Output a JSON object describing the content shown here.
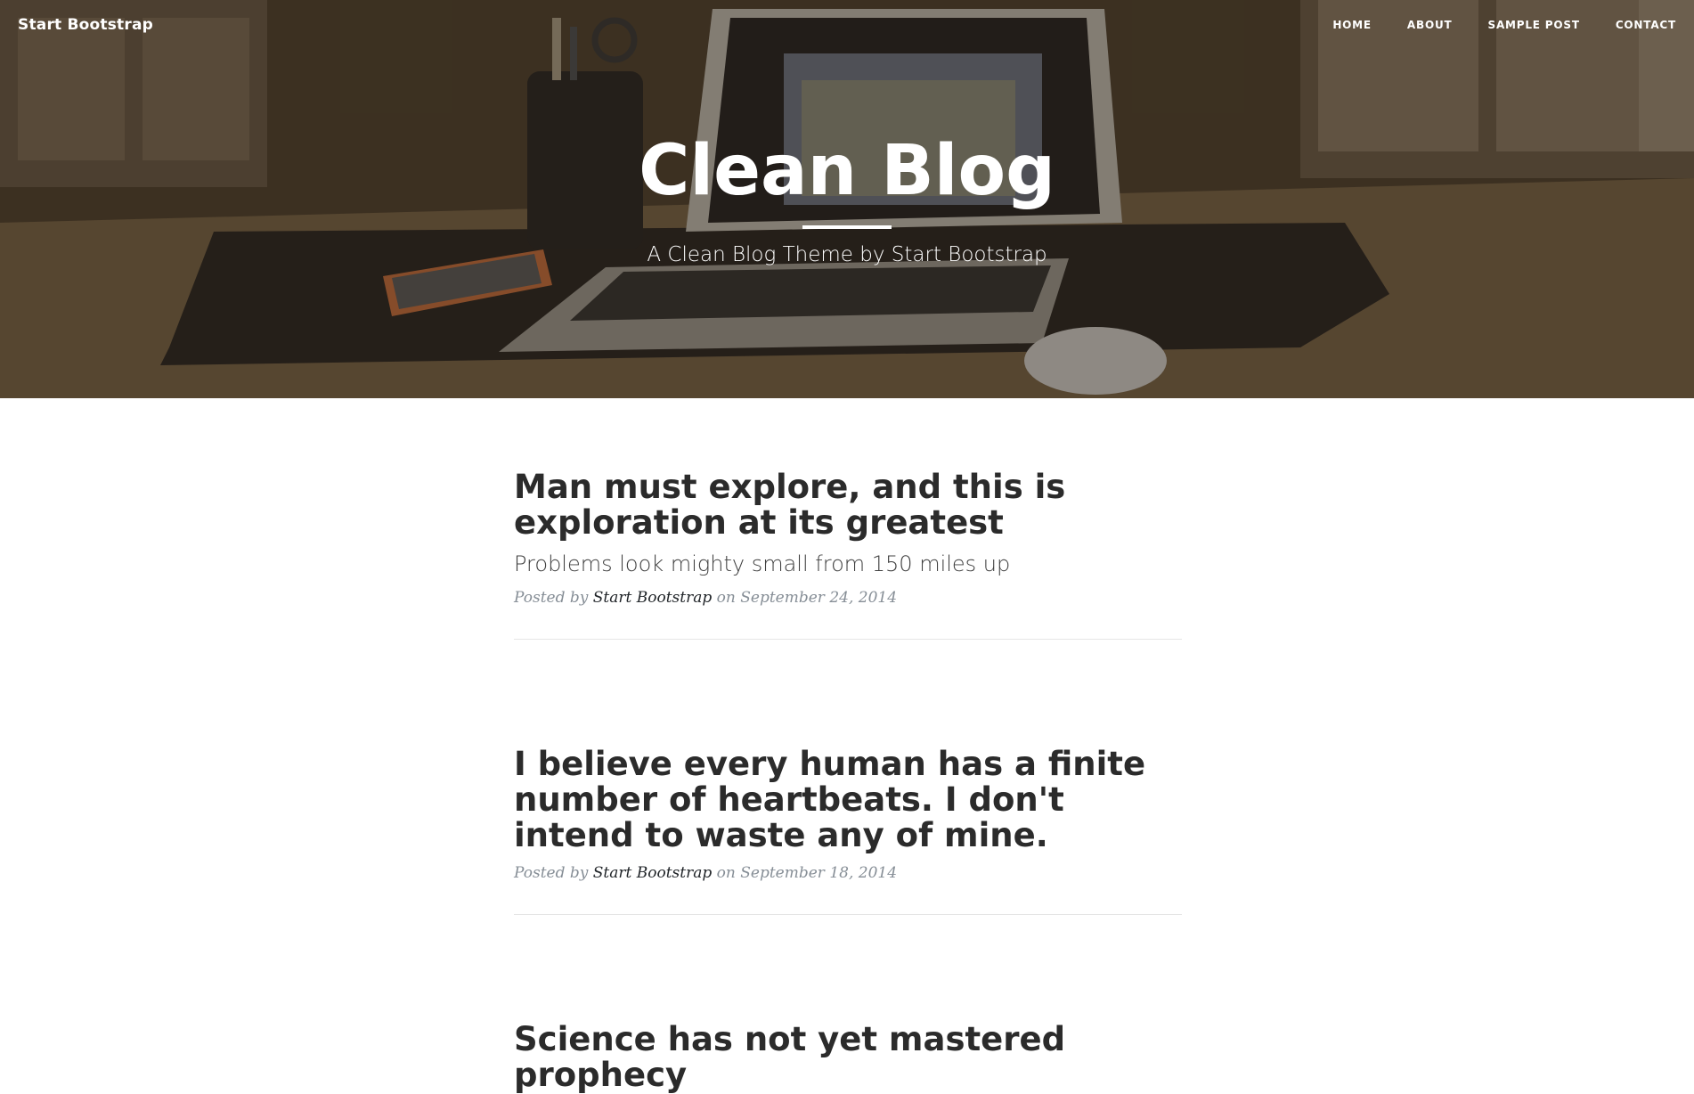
{
  "navbar": {
    "brand": "Start Bootstrap",
    "links": [
      "HOME",
      "ABOUT",
      "SAMPLE POST",
      "CONTACT"
    ]
  },
  "hero": {
    "title": "Clean Blog",
    "subtitle": "A Clean Blog Theme by Start Bootstrap"
  },
  "posts": [
    {
      "title": "Man must explore, and this is exploration at its greatest",
      "subtitle": "Problems look mighty small from 150 miles up",
      "meta_prefix": "Posted by",
      "author": "Start Bootstrap",
      "meta_on": "on",
      "date": "September 24, 2014"
    },
    {
      "title": "I believe every human has a finite number of heartbeats. I don't intend to waste any of mine.",
      "subtitle": "",
      "meta_prefix": "Posted by",
      "author": "Start Bootstrap",
      "meta_on": "on",
      "date": "September 18, 2014"
    },
    {
      "title": "Science has not yet mastered prophecy"
    }
  ],
  "colors": {
    "heading_text": "#2b2b2b",
    "meta_text": "#868e96",
    "divider": "#e5e5e5"
  }
}
